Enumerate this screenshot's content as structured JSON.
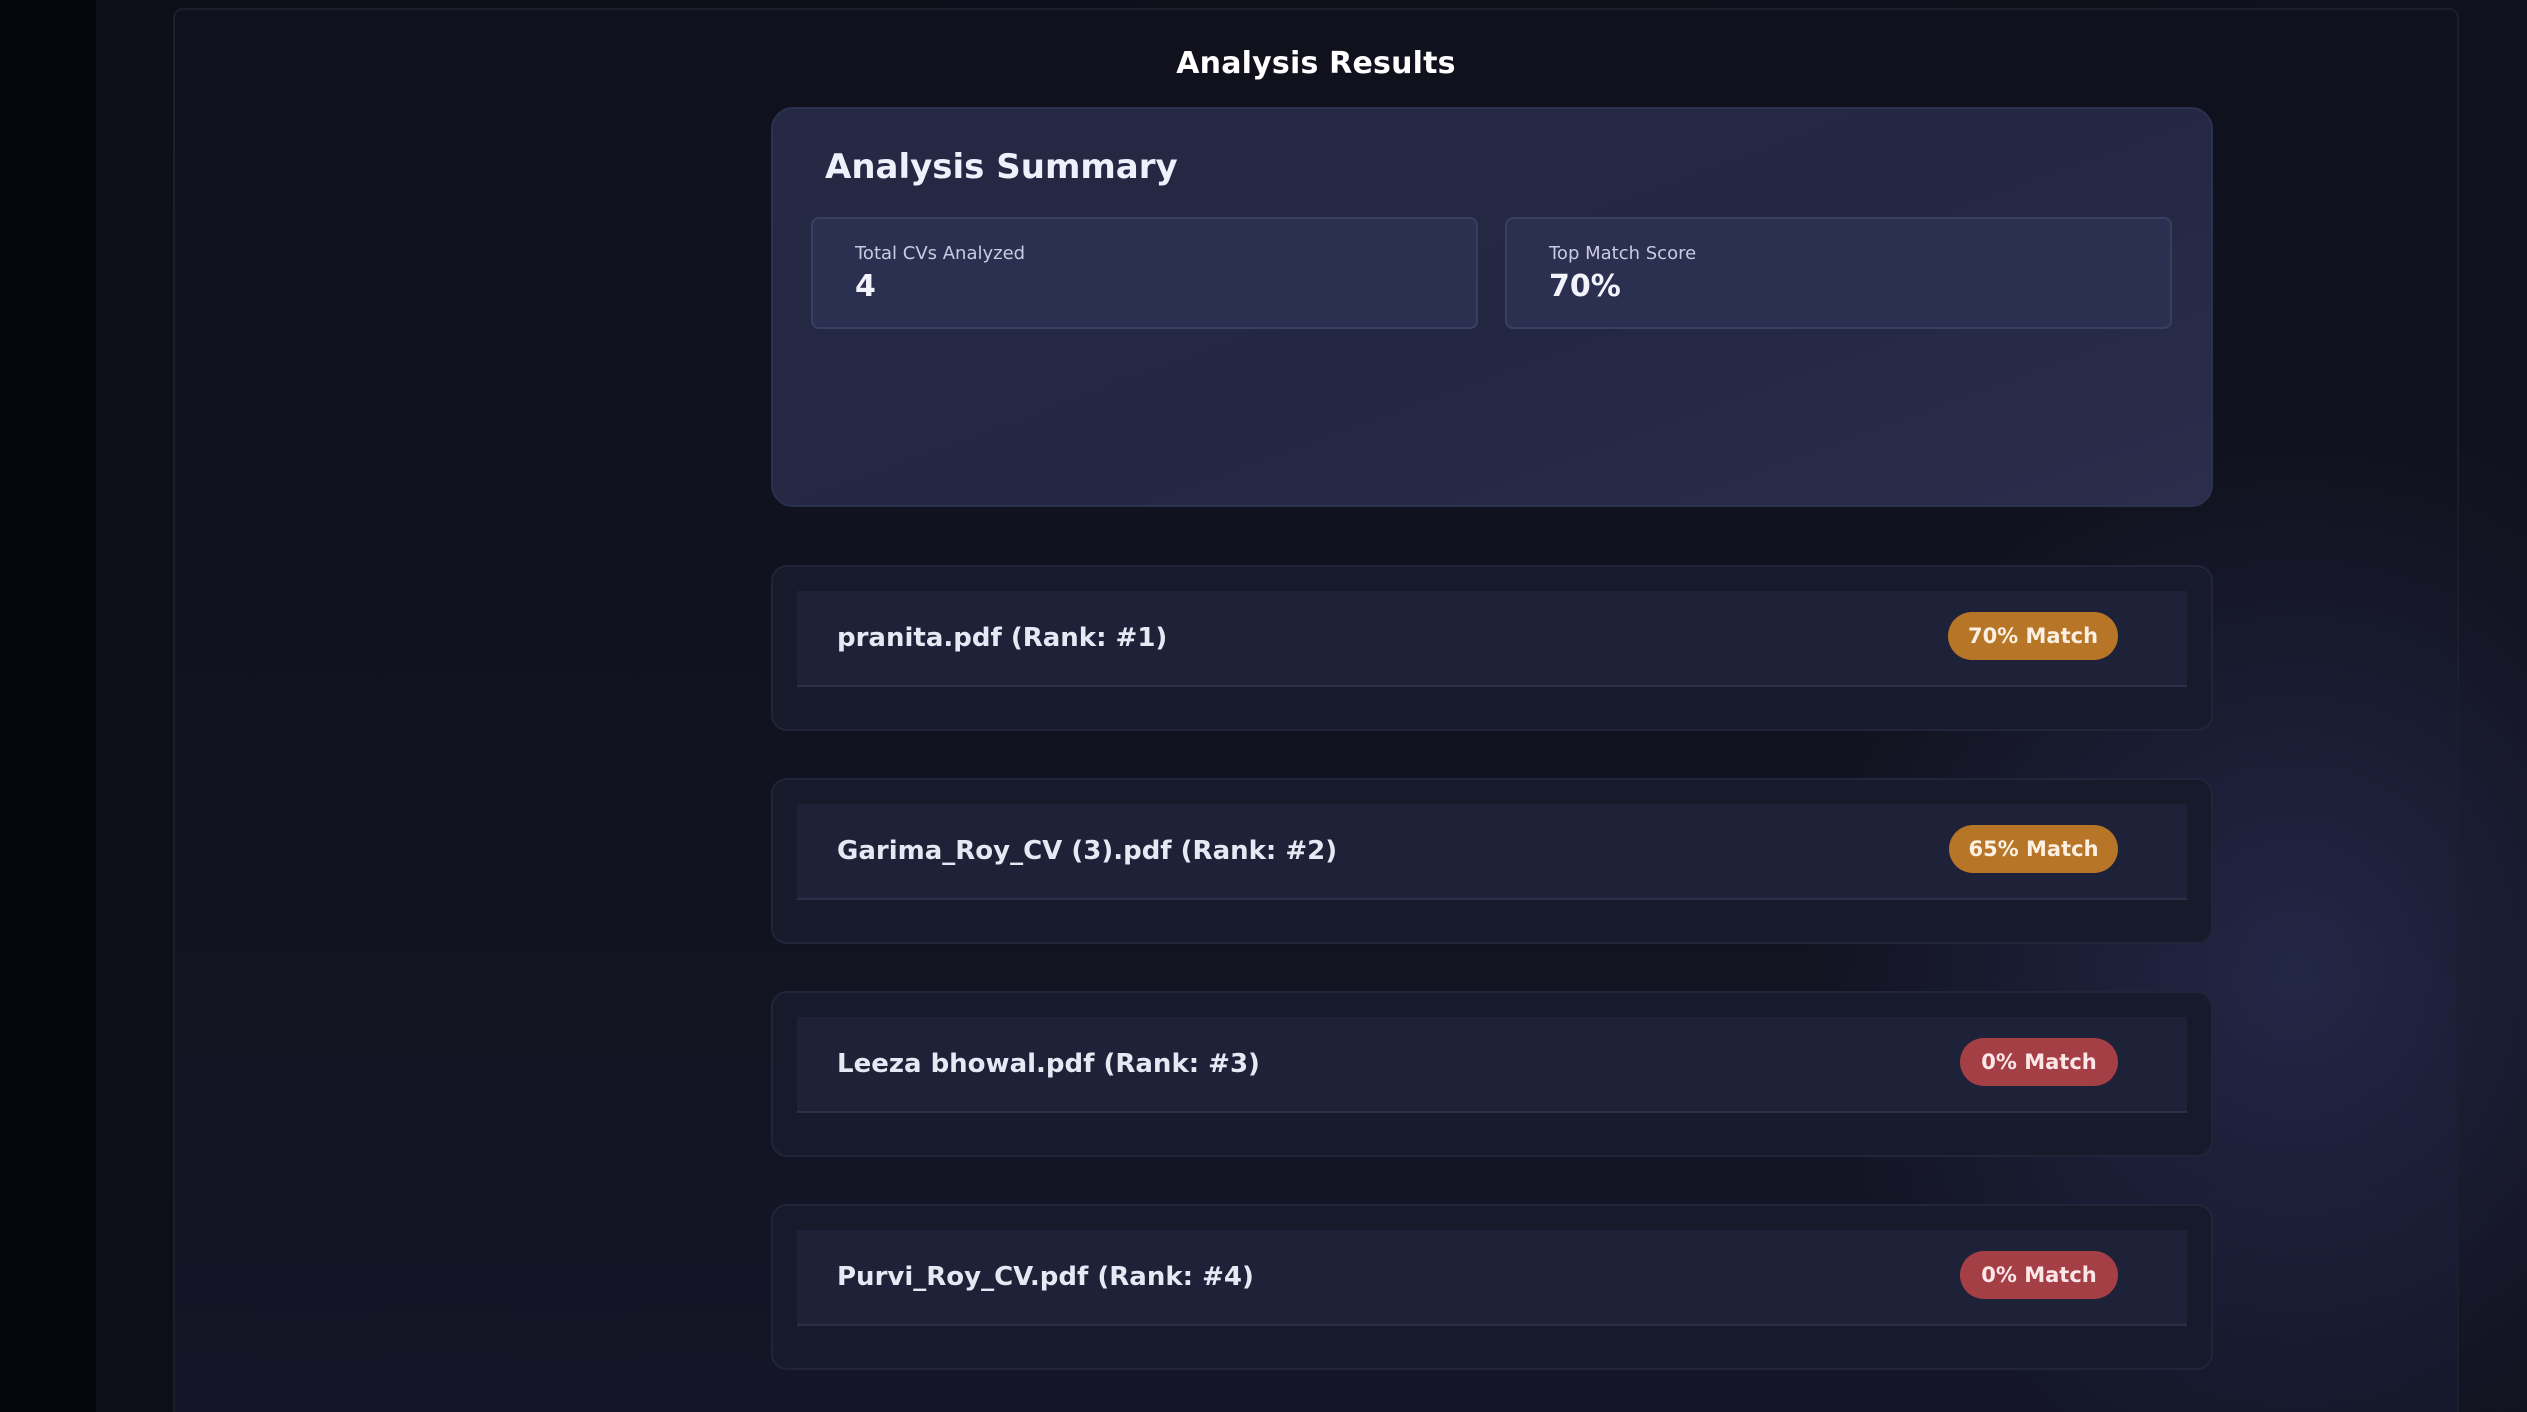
{
  "page": {
    "title": "Analysis Results"
  },
  "summary": {
    "title": "Analysis Summary",
    "stats": [
      {
        "label": "Total CVs Analyzed",
        "value": "4"
      },
      {
        "label": "Top Match Score",
        "value": "70%"
      }
    ]
  },
  "results": [
    {
      "name": "pranita.pdf (Rank: #1)",
      "badge": "70% Match",
      "status_color": "#b77528"
    },
    {
      "name": "Garima_Roy_CV (3).pdf (Rank: #2)",
      "badge": "65% Match",
      "status_color": "#b77528"
    },
    {
      "name": "Leeza bhowal.pdf (Rank: #3)",
      "badge": "0% Match",
      "status_color": "#a53f46"
    },
    {
      "name": "Purvi_Roy_CV.pdf (Rank: #4)",
      "badge": "0% Match",
      "status_color": "#a53f46"
    }
  ],
  "colors": {
    "background": "#0b0c15",
    "panel": "#10111d",
    "card": "#252944",
    "accent_orange": "#b77528",
    "accent_red": "#a53f46"
  }
}
